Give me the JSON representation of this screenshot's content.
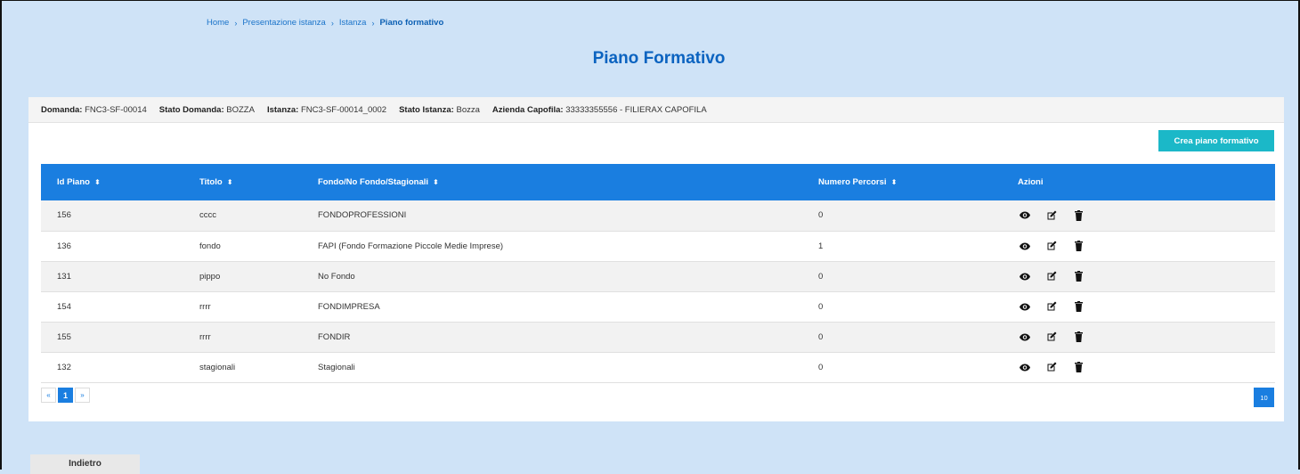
{
  "breadcrumb": {
    "items": [
      "Home",
      "Presentazione istanza",
      "Istanza"
    ],
    "current": "Piano formativo",
    "separator": "›"
  },
  "page_title": "Piano Formativo",
  "info": {
    "domanda_label": "Domanda:",
    "domanda_value": "FNC3-SF-00014",
    "stato_domanda_label": "Stato Domanda:",
    "stato_domanda_value": "BOZZA",
    "istanza_label": "Istanza:",
    "istanza_value": "FNC3-SF-00014_0002",
    "stato_istanza_label": "Stato Istanza:",
    "stato_istanza_value": "Bozza",
    "azienda_label": "Azienda Capofila:",
    "azienda_value": "33333355556 - FILIERAX CAPOFILA"
  },
  "create_button": "Crea piano formativo",
  "table": {
    "headers": [
      "Id Piano",
      "Titolo",
      "Fondo/No Fondo/Stagionali",
      "Numero Percorsi",
      "Azioni"
    ],
    "sort_icon": "⬍",
    "rows": [
      {
        "id": "156",
        "titolo": "cccc",
        "fondo": "FONDOPROFESSIONI",
        "percorsi": "0"
      },
      {
        "id": "136",
        "titolo": "fondo",
        "fondo": "FAPI (Fondo Formazione Piccole Medie Imprese)",
        "percorsi": "1"
      },
      {
        "id": "131",
        "titolo": "pippo",
        "fondo": "No Fondo",
        "percorsi": "0"
      },
      {
        "id": "154",
        "titolo": "rrrr",
        "fondo": "FONDIMPRESA",
        "percorsi": "0"
      },
      {
        "id": "155",
        "titolo": "rrrr",
        "fondo": "FONDIR",
        "percorsi": "0"
      },
      {
        "id": "132",
        "titolo": "stagionali",
        "fondo": "Stagionali",
        "percorsi": "0"
      }
    ]
  },
  "pager": {
    "prev": "«",
    "current": "1",
    "next": "»"
  },
  "page_size": "10",
  "back_button": "Indietro",
  "colors": {
    "primary": "#1a7ee0",
    "accent": "#1bb8c8",
    "background": "#cfe3f7",
    "title": "#0b63c0"
  }
}
